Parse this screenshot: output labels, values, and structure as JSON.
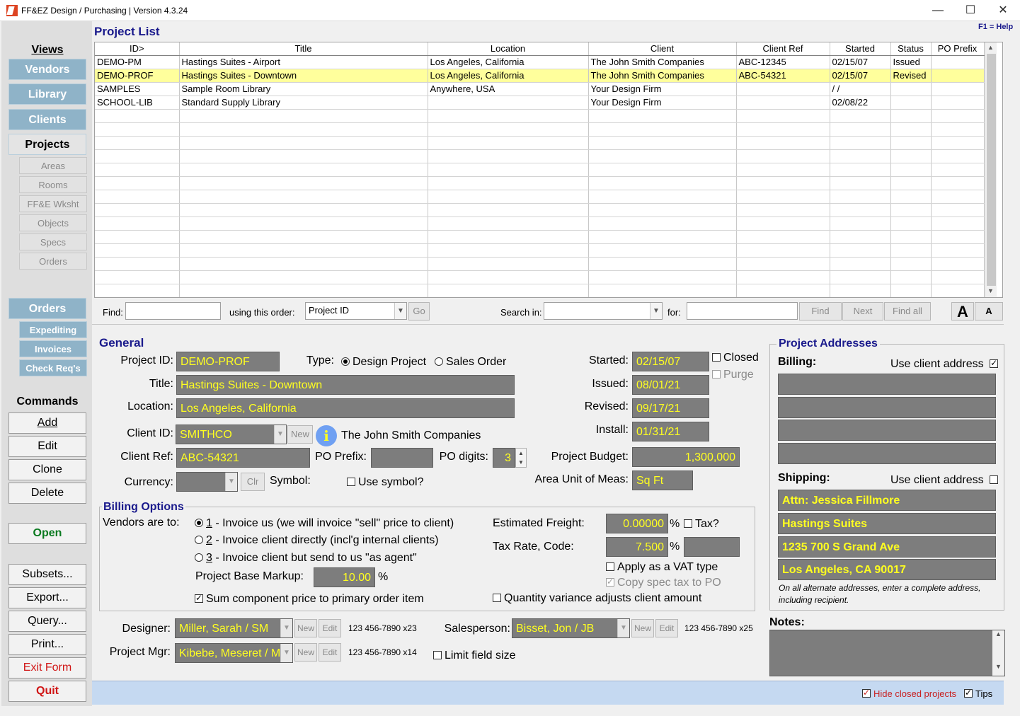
{
  "window": {
    "title": "FF&EZ Design / Purchasing | Version 4.3.24",
    "minimize": "—",
    "maximize": "☐",
    "close": "✕"
  },
  "nav": {
    "views_label": "Views",
    "vendors": "Vendors",
    "library": "Library",
    "clients": "Clients",
    "projects": "Projects",
    "areas": "Areas",
    "rooms": "Rooms",
    "ffe_wksht": "FF&E Wksht",
    "objects": "Objects",
    "specs": "Specs",
    "orders_sub": "Orders",
    "orders": "Orders",
    "expediting": "Expediting",
    "invoices": "Invoices",
    "check_reqs": "Check Req's",
    "commands_label": "Commands",
    "add": "Add",
    "edit": "Edit",
    "clone": "Clone",
    "delete": "Delete",
    "open": "Open",
    "subsets": "Subsets...",
    "export": "Export...",
    "query": "Query...",
    "print": "Print...",
    "exit_form": "Exit Form",
    "quit": "Quit"
  },
  "project_list": {
    "heading": "Project List",
    "help": "F1 = Help",
    "columns": [
      "ID>",
      "Title",
      "Location",
      "Client",
      "Client Ref",
      "Started",
      "Status",
      "PO Prefix"
    ],
    "rows": [
      [
        "DEMO-PM",
        "Hastings Suites - Airport",
        "Los Angeles, California",
        "The John Smith Companies",
        "ABC-12345",
        "02/15/07",
        "Issued",
        ""
      ],
      [
        "DEMO-PROF",
        "Hastings Suites - Downtown",
        "Los Angeles, California",
        "The John Smith Companies",
        "ABC-54321",
        "02/15/07",
        "Revised",
        ""
      ],
      [
        "SAMPLES",
        "Sample Room Library",
        "Anywhere, USA",
        "Your Design Firm",
        "",
        "/  /",
        "",
        ""
      ],
      [
        "SCHOOL-LIB",
        "Standard Supply Library",
        "",
        "Your Design Firm",
        "",
        "02/08/22",
        "",
        ""
      ]
    ],
    "selected_row": 1
  },
  "findbar": {
    "find_label": "Find:",
    "find_value": "",
    "order_label": "using this order:",
    "order_value": "Project ID",
    "go": "Go",
    "search_in_label": "Search in:",
    "search_in_value": "",
    "for_label": "for:",
    "for_value": "",
    "find_btn": "Find",
    "next_btn": "Next",
    "find_all_btn": "Find all",
    "font_large": "A",
    "font_small": "A"
  },
  "general": {
    "heading": "General",
    "project_id_label": "Project ID:",
    "project_id": "DEMO-PROF",
    "type_label": "Type:",
    "type_design": "Design Project",
    "type_sales": "Sales Order",
    "title_label": "Title:",
    "title": "Hastings Suites - Downtown",
    "location_label": "Location:",
    "location": "Los Angeles, California",
    "client_id_label": "Client ID:",
    "client_id": "SMITHCO",
    "new_btn": "New",
    "client_name": "The John Smith Companies",
    "client_ref_label": "Client Ref:",
    "client_ref": "ABC-54321",
    "po_prefix_label": "PO Prefix:",
    "po_prefix": "",
    "po_digits_label": "PO digits:",
    "po_digits": "3",
    "currency_label": "Currency:",
    "currency": "",
    "clr_btn": "Clr",
    "symbol_label": "Symbol:",
    "use_symbol": "Use symbol?",
    "started_label": "Started:",
    "started": "02/15/07",
    "closed": "Closed",
    "purge": "Purge",
    "issued_label": "Issued:",
    "issued": "08/01/21",
    "revised_label": "Revised:",
    "revised": "09/17/21",
    "install_label": "Install:",
    "install": "01/31/21",
    "budget_label": "Project Budget:",
    "budget": "1,300,000",
    "area_unit_label": "Area Unit of Meas:",
    "area_unit": "Sq Ft"
  },
  "billing": {
    "heading": "Billing Options",
    "vendors_label": "Vendors are to:",
    "opt1_num": "1",
    "opt1": " - Invoice us (we will invoice \"sell\" price to client)",
    "opt2_num": "2",
    "opt2": " - Invoice client directly (incl'g internal clients)",
    "opt3_num": "3",
    "opt3": " - Invoice client but send to us \"as agent\"",
    "markup_label": "Project Base Markup:",
    "markup": "10.00",
    "pct": "%",
    "sum_component": "Sum component price to primary order item",
    "freight_label": "Estimated Freight:",
    "freight": "0.00000",
    "tax_q": "Tax?",
    "tax_rate_label": "Tax Rate, Code:",
    "tax_rate": "7.500",
    "tax_code": "",
    "vat": "Apply as a VAT type",
    "copy_spec_tax": "Copy spec tax to PO",
    "qty_variance": "Quantity variance adjusts client amount"
  },
  "staff": {
    "designer_label": "Designer:",
    "designer": "Miller, Sarah / SM",
    "designer_phone": "123 456-7890 x23",
    "pm_label": "Project Mgr:",
    "pm": "Kibebe, Meseret / M",
    "pm_phone": "123 456-7890 x14",
    "sales_label": "Salesperson:",
    "sales": "Bisset, Jon / JB",
    "sales_phone": "123 456-7890 x25",
    "new_btn": "New",
    "edit_btn": "Edit",
    "limit_field": "Limit field size"
  },
  "addresses": {
    "heading": "Project Addresses",
    "billing_label": "Billing:",
    "use_client_addr": "Use client address",
    "billing_lines": [
      "",
      "",
      "",
      ""
    ],
    "shipping_label": "Shipping:",
    "shipping_lines": [
      "Attn: Jessica Fillmore",
      "Hastings Suites",
      "1235 700 S Grand Ave",
      "Los Angeles, CA 90017"
    ],
    "note": "On all alternate addresses, enter a complete address, including recipient."
  },
  "notes": {
    "label": "Notes:",
    "value": ""
  },
  "status": {
    "hide_closed": "Hide closed projects",
    "tips": "Tips"
  }
}
